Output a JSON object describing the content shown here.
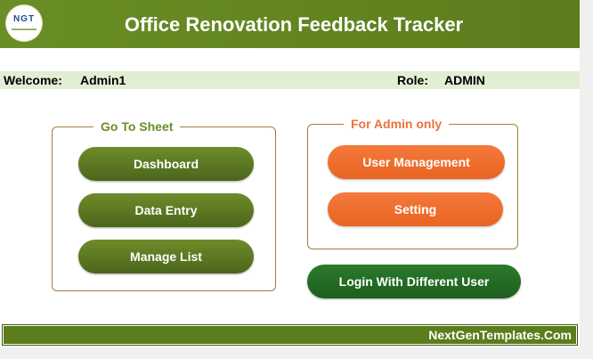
{
  "header": {
    "logo_text": "NGT",
    "title": "Office Renovation Feedback Tracker"
  },
  "user_bar": {
    "welcome_label": "Welcome:",
    "username": "Admin1",
    "role_label": "Role:",
    "role": "ADMIN"
  },
  "goto_sheet": {
    "legend": "Go To Sheet",
    "buttons": [
      "Dashboard",
      "Data Entry",
      "Manage List"
    ]
  },
  "admin_only": {
    "legend": "For Admin only",
    "buttons": [
      "User Management",
      "Setting"
    ]
  },
  "login_button": "Login With Different User",
  "footer": {
    "text": "NextGenTemplates.Com"
  },
  "colors": {
    "header_green": "#5b7d1c",
    "button_green": "#5a7820",
    "button_orange": "#f26e30",
    "button_dark_green": "#236b24",
    "legend_green": "#6a8e25",
    "legend_orange": "#e8733a",
    "welcome_bar_bg": "#e3edd3"
  }
}
